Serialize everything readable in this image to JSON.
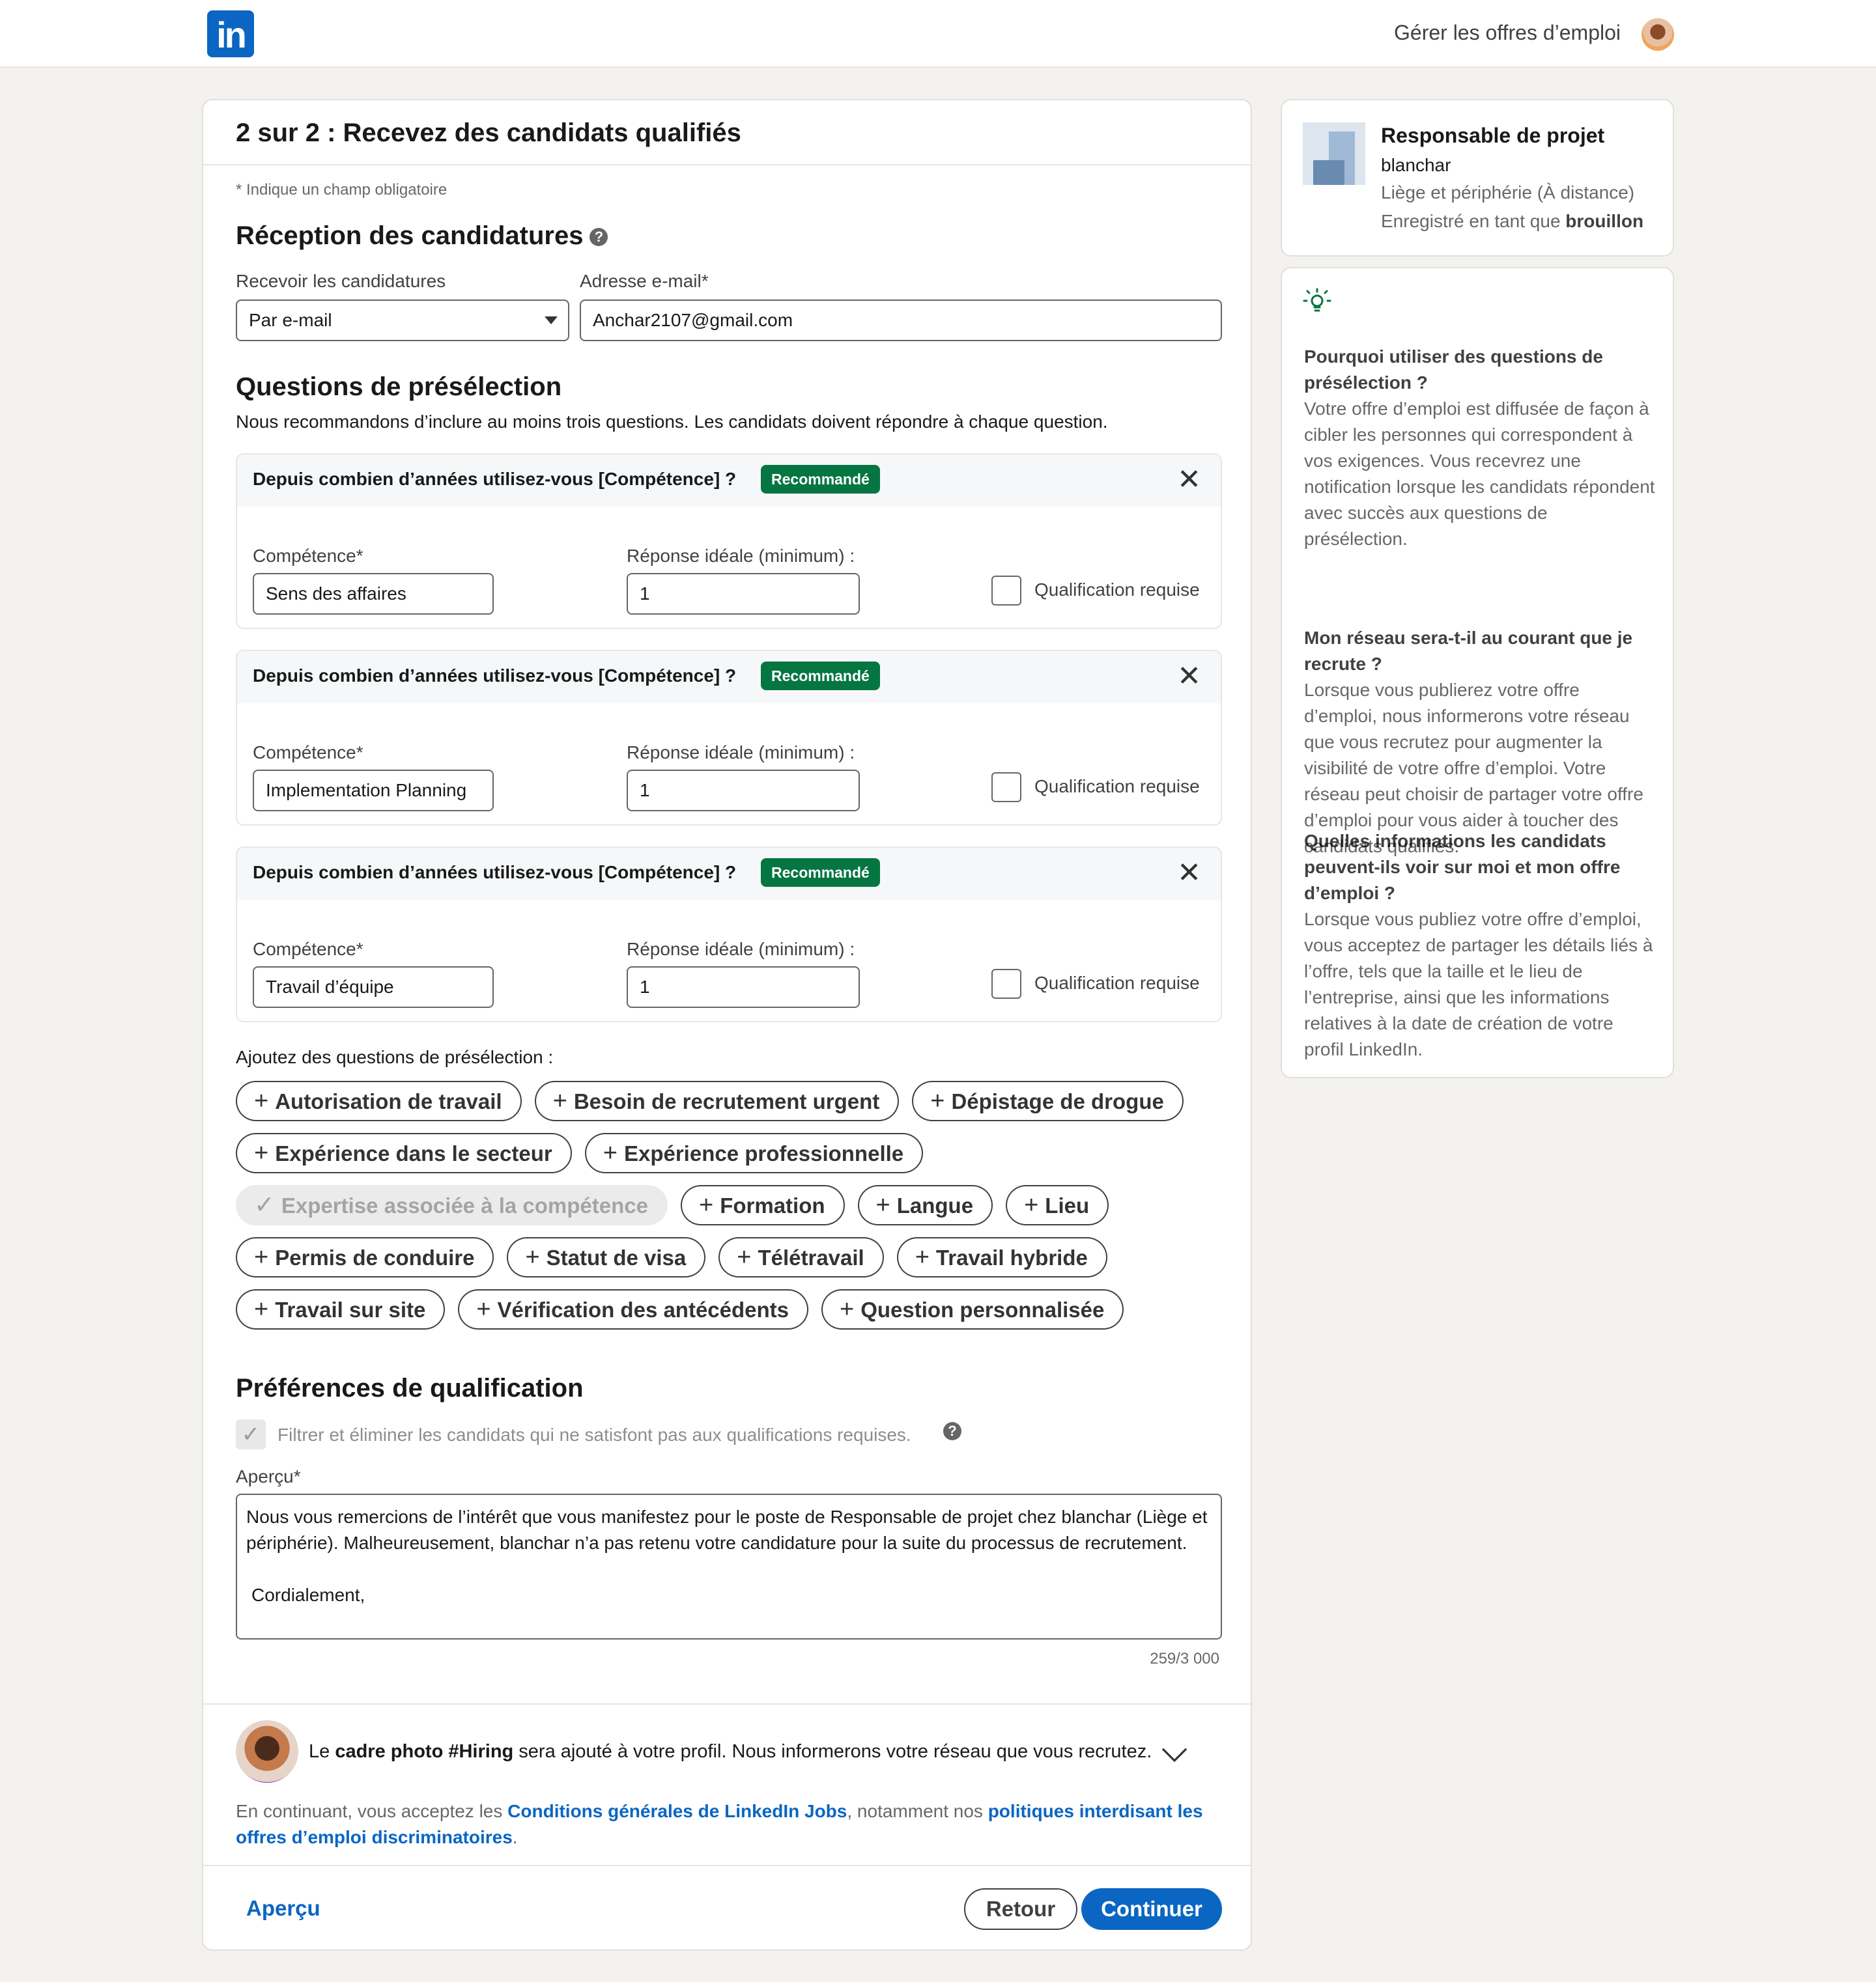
{
  "header": {
    "logo_text": "in",
    "manage_jobs": "Gérer les offres d’emploi"
  },
  "main": {
    "title": "2 sur 2 : Recevez des candidats qualifiés",
    "required_note": "* Indique un champ obligatoire",
    "reception": {
      "heading": "Réception des candidatures",
      "receive_label": "Recevoir les candidatures",
      "receive_value": "Par e-mail",
      "email_label": "Adresse e-mail*",
      "email_value": "Anchar2107@gmail.com"
    },
    "screening": {
      "heading": "Questions de présélection",
      "subtitle": "Nous recommandons d’inclure au moins trois questions. Les candidats doivent répondre à chaque question.",
      "questions": [
        {
          "title": "Depuis combien d’années utilisez-vous [Compétence] ?",
          "badge": "Recommandé",
          "skill_label": "Compétence*",
          "skill_value": "Sens des affaires",
          "answer_label": "Réponse idéale (minimum) :",
          "answer_value": "1",
          "required_label": "Qualification requise"
        },
        {
          "title": "Depuis combien d’années utilisez-vous [Compétence] ?",
          "badge": "Recommandé",
          "skill_label": "Compétence*",
          "skill_value": "Implementation Planning",
          "answer_label": "Réponse idéale (minimum) :",
          "answer_value": "1",
          "required_label": "Qualification requise"
        },
        {
          "title": "Depuis combien d’années utilisez-vous [Compétence] ?",
          "badge": "Recommandé",
          "skill_label": "Compétence*",
          "skill_value": "Travail d’équipe",
          "answer_label": "Réponse idéale (minimum) :",
          "answer_value": "1",
          "required_label": "Qualification requise"
        }
      ],
      "add_label": "Ajoutez des questions de présélection :",
      "pills": {
        "autorisation": "Autorisation de travail",
        "urgent": "Besoin de recrutement urgent",
        "drogue": "Dépistage de drogue",
        "secteur": "Expérience dans le secteur",
        "pro": "Expérience professionnelle",
        "expertise": "Expertise associée à la compétence",
        "formation": "Formation",
        "langue": "Langue",
        "lieu": "Lieu",
        "permis": "Permis de conduire",
        "visa": "Statut de visa",
        "teletravail": "Télétravail",
        "hybride": "Travail hybride",
        "site": "Travail sur site",
        "antecedents": "Vérification des antécédents",
        "perso": "Question personnalisée"
      }
    },
    "preferences": {
      "heading": "Préférences de qualification",
      "filter_text": "Filtrer et éliminer les candidats qui ne satisfont pas aux qualifications requises.",
      "preview_label": "Aperçu*",
      "preview_line1": "Nous vous remercions de l’intérêt que vous manifestez pour le poste de Responsable de projet chez blanchar (Liège et périphérie). Malheureusement, blanchar n’a pas retenu votre candidature pour la suite du processus de recrutement.",
      "preview_line2": "Cordialement,",
      "counter": "259/3 000"
    },
    "hiring": {
      "prefix": "Le ",
      "bold": "cadre photo #Hiring",
      "suffix": " sera ajouté à votre profil. Nous informerons votre réseau que vous recrutez."
    },
    "terms": {
      "t1": "En continuant, vous acceptez les ",
      "link1": "Conditions générales de LinkedIn Jobs",
      "t2": ", notamment nos ",
      "link2": "politiques interdisant les offres d’emploi discriminatoires",
      "t3": "."
    },
    "footer": {
      "preview": "Aperçu",
      "back": "Retour",
      "continue": "Continuer"
    }
  },
  "job": {
    "title": "Responsable de projet",
    "company": "blanchar",
    "location": "Liège et périphérie (À distance)",
    "status_prefix": "Enregistré en tant que ",
    "status_bold": "brouillon"
  },
  "tips": [
    {
      "q": "Pourquoi utiliser des questions de présélection ?",
      "a": "Votre offre d’emploi est diffusée de façon à cibler les personnes qui correspondent à vos exigences. Vous recevrez une notification lorsque les candidats répondent avec succès aux questions de présélection."
    },
    {
      "q": "Mon réseau sera-t-il au courant que je recrute ?",
      "a": "Lorsque vous publierez votre offre d’emploi, nous informerons votre réseau que vous recrutez pour augmenter la visibilité de votre offre d’emploi. Votre réseau peut choisir de partager votre offre d’emploi pour vous aider à toucher des candidats qualifiés."
    },
    {
      "q": "Quelles informations les candidats peuvent-ils voir sur moi et mon offre d’emploi ?",
      "a": "Lorsque vous publiez votre offre d’emploi, vous acceptez de partager les détails liés à l’offre, tels que la taille et le lieu de l’entreprise, ainsi que les informations relatives à la date de création de votre profil LinkedIn."
    }
  ],
  "colors": {
    "brand": "#0a66c2",
    "badge": "#057642",
    "background": "#f4f2ee"
  },
  "icons": [
    "linkedin-logo",
    "help-icon",
    "close-icon",
    "plus-icon",
    "check-icon",
    "chevron-down-icon",
    "lightbulb-icon"
  ]
}
